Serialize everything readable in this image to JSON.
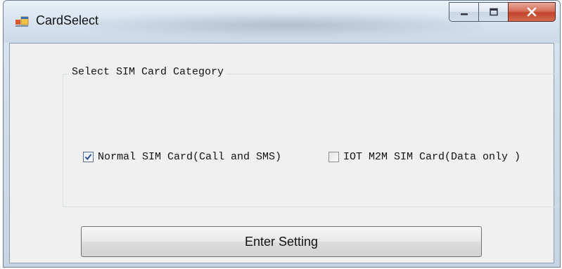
{
  "window": {
    "title": "CardSelect",
    "controls": {
      "minimize_icon": "minimize-icon",
      "maximize_icon": "maximize-icon",
      "close_icon": "close-icon"
    }
  },
  "group": {
    "label": "Select SIM Card Category",
    "options": [
      {
        "label": "Normal SIM Card(Call and SMS)",
        "checked": true
      },
      {
        "label": "IOT M2M SIM Card(Data only )",
        "checked": false
      }
    ]
  },
  "actions": {
    "enter_label": "Enter Setting"
  },
  "colors": {
    "close_button": "#c2442b",
    "client_background": "#f0f0f0",
    "check_mark": "#2a4f8f"
  }
}
